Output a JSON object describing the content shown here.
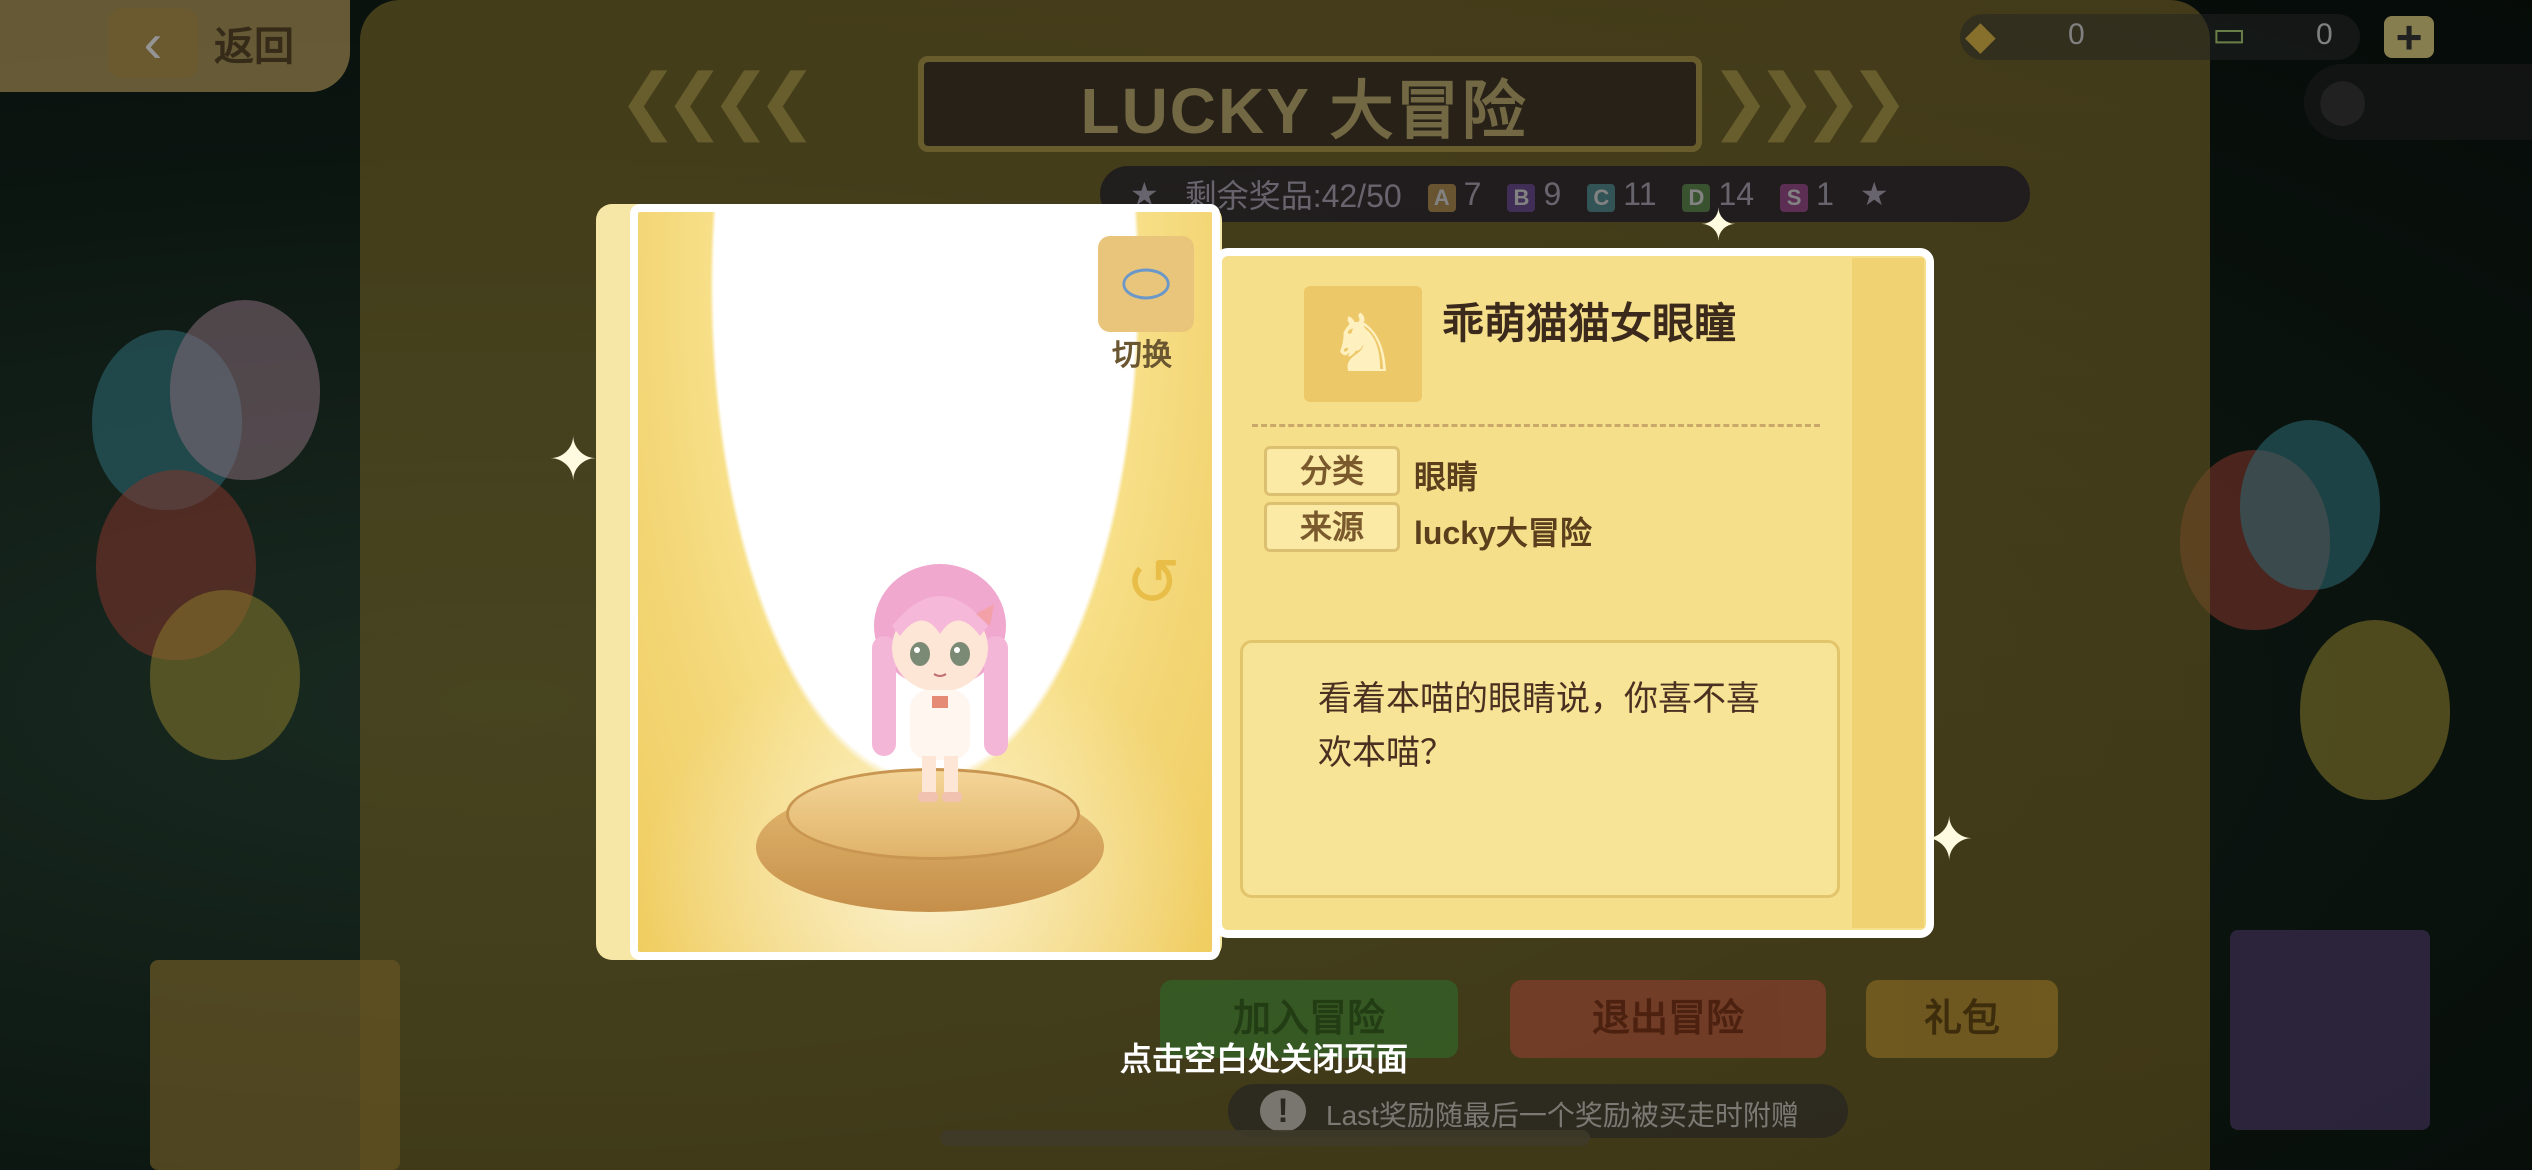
{
  "top_bar": {
    "back_label": "返回",
    "gem_count": "0",
    "ticket_count": "0",
    "add_symbol": "+"
  },
  "machine": {
    "title": "LUCKY 大冒险",
    "remaining_label": "剩余奖品:42/50",
    "tiers": [
      {
        "tier": "A",
        "count": "7",
        "color": "#c9a35a"
      },
      {
        "tier": "B",
        "count": "9",
        "color": "#7b56a6"
      },
      {
        "tier": "C",
        "count": "11",
        "color": "#5ea2a6"
      },
      {
        "tier": "D",
        "count": "14",
        "color": "#6aa05a"
      },
      {
        "tier": "S",
        "count": "1",
        "color": "#b456a0"
      }
    ],
    "buttons": {
      "join": "加入冒险",
      "quit": "退出冒险",
      "gift": "礼包"
    },
    "tip": "Last奖励随最后一个奖励被买走时附赠"
  },
  "preview": {
    "switch_label": "切换"
  },
  "item": {
    "name": "乖萌猫猫女眼瞳",
    "category_label": "分类",
    "category_value": "眼睛",
    "source_label": "来源",
    "source_value": "lucky大冒险",
    "description": "看着本喵的眼睛说，你喜不喜欢本喵？"
  },
  "close_hint": "点击空白处关闭页面",
  "colors": {
    "panel_bg": "#f5df8a",
    "accent_gold": "#e8bd48",
    "join_btn": "#5aa542",
    "quit_btn": "#d86a4a",
    "gift_btn": "#d4a63a"
  }
}
